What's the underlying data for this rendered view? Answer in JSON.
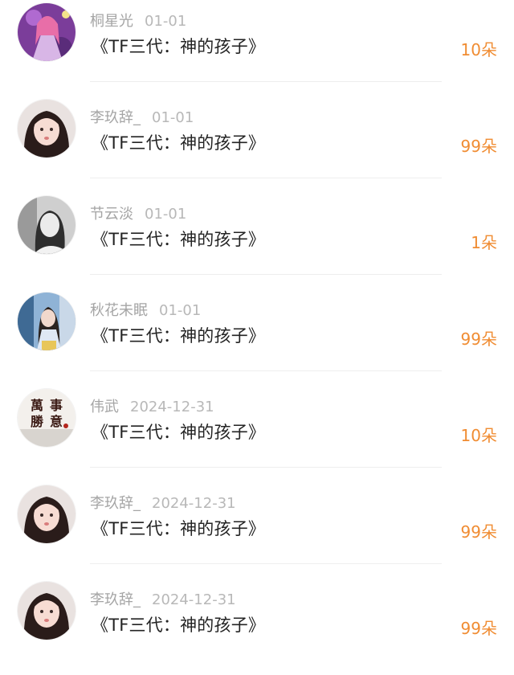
{
  "rows": [
    {
      "name": "桐星光",
      "date": "01-01",
      "title": "《TF三代：神的孩子》",
      "gift": "10朵",
      "avatar": "anime-girl-purple"
    },
    {
      "name": "李玖辞_",
      "date": "01-01",
      "title": "《TF三代：神的孩子》",
      "gift": "99朵",
      "avatar": "girl-portrait"
    },
    {
      "name": "节云淡",
      "date": "01-01",
      "title": "《TF三代：神的孩子》",
      "gift": "1朵",
      "avatar": "gray-portrait"
    },
    {
      "name": "秋花未眠",
      "date": "01-01",
      "title": "《TF三代：神的孩子》",
      "gift": "99朵",
      "avatar": "girl-blue-dress"
    },
    {
      "name": "伟武",
      "date": "2024-12-31",
      "title": "《TF三代：神的孩子》",
      "gift": "10朵",
      "avatar": "calligraphy"
    },
    {
      "name": "李玖辞_",
      "date": "2024-12-31",
      "title": "《TF三代：神的孩子》",
      "gift": "99朵",
      "avatar": "girl-portrait"
    },
    {
      "name": "李玖辞_",
      "date": "2024-12-31",
      "title": "《TF三代：神的孩子》",
      "gift": "99朵",
      "avatar": "girl-portrait"
    }
  ],
  "calligraphy_text": [
    "萬",
    "事",
    "勝",
    "意"
  ],
  "colors": {
    "gift": "#f08c32",
    "name": "#a5a5a5",
    "title": "#232323"
  }
}
